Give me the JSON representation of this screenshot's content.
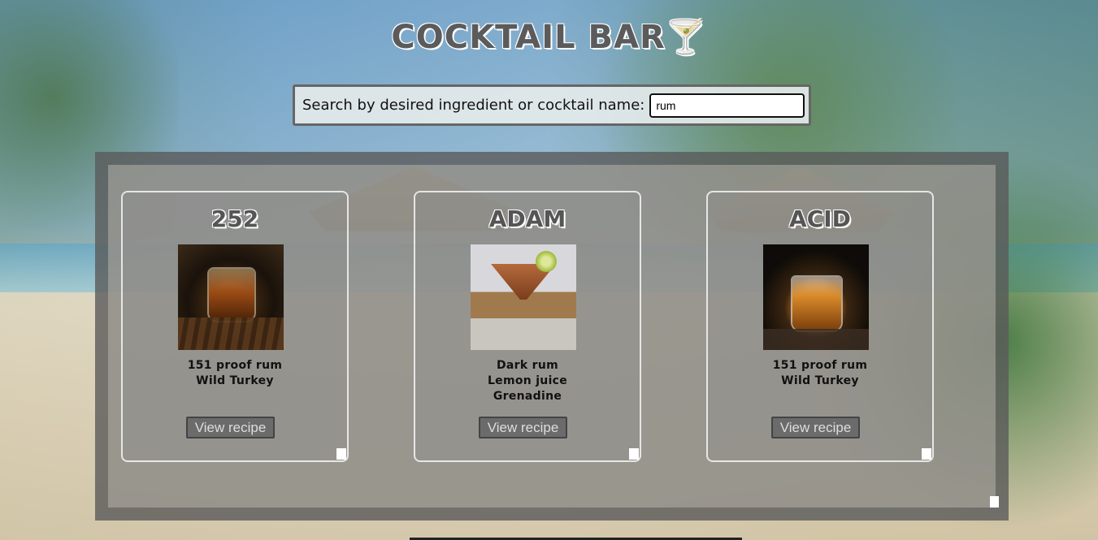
{
  "header": {
    "title": "COCKTAIL BAR",
    "icon": "martini-glass-icon"
  },
  "search": {
    "label": "Search by desired ingredient or cocktail name:",
    "value": "rum",
    "placeholder": ""
  },
  "results": [
    {
      "name": "252",
      "ingredients": [
        "151 proof rum",
        "Wild Turkey"
      ],
      "button_label": "View recipe"
    },
    {
      "name": "ADAM",
      "ingredients": [
        "Dark rum",
        "Lemon juice",
        "Grenadine"
      ],
      "button_label": "View recipe"
    },
    {
      "name": "ACID",
      "ingredients": [
        "151 proof rum",
        "Wild Turkey"
      ],
      "button_label": "View recipe"
    }
  ]
}
